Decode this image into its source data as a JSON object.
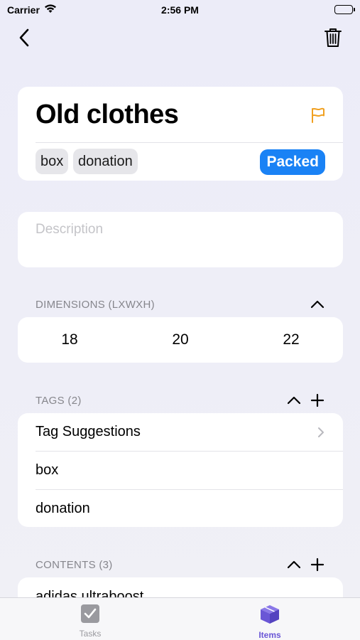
{
  "status_bar": {
    "carrier": "Carrier",
    "time": "2:56 PM"
  },
  "item": {
    "title": "Old clothes",
    "chips": [
      "box",
      "donation"
    ],
    "status_label": "Packed"
  },
  "description": {
    "placeholder": "Description",
    "value": ""
  },
  "dimensions": {
    "header": "DIMENSIONS (LXWXH)",
    "length": "18",
    "width": "20",
    "height": "22"
  },
  "tags": {
    "header": "TAGS (2)",
    "suggestions_label": "Tag Suggestions",
    "items": [
      "box",
      "donation"
    ]
  },
  "contents": {
    "header": "CONTENTS (3)",
    "items": [
      "adidas ultraboost"
    ]
  },
  "tab_bar": {
    "tabs": [
      {
        "label": "Tasks",
        "icon": "checkbox-icon",
        "selected": false
      },
      {
        "label": "Items",
        "icon": "cube-icon",
        "selected": true
      }
    ]
  },
  "colors": {
    "accent": "#1a82f5",
    "flag": "#f0a020",
    "tab_selected": "#6a56d6"
  }
}
